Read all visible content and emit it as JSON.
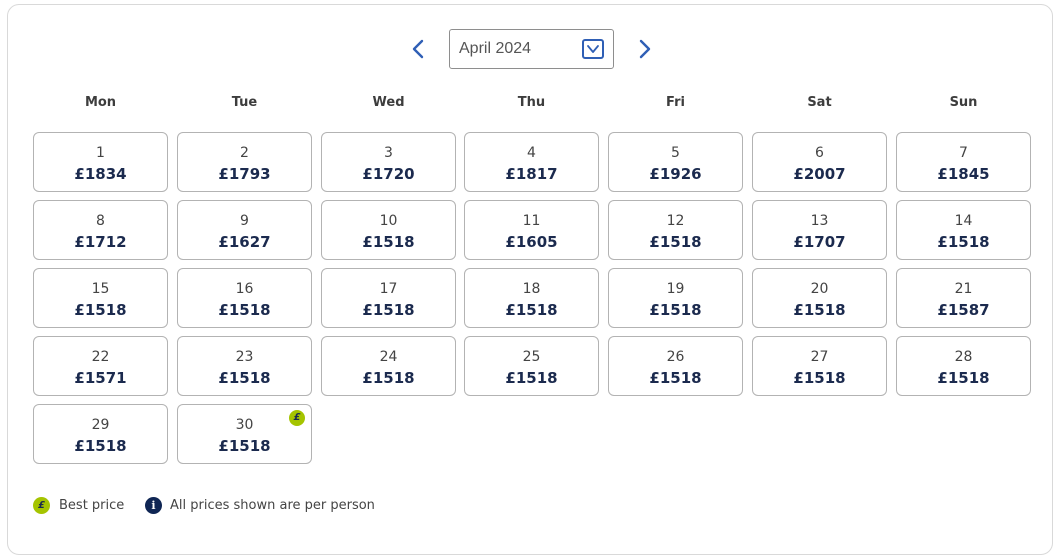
{
  "calendar": {
    "month_label": "April 2024",
    "weekdays": [
      "Mon",
      "Tue",
      "Wed",
      "Thu",
      "Fri",
      "Sat",
      "Sun"
    ],
    "days": [
      {
        "day": "1",
        "price": "£1834"
      },
      {
        "day": "2",
        "price": "£1793"
      },
      {
        "day": "3",
        "price": "£1720"
      },
      {
        "day": "4",
        "price": "£1817"
      },
      {
        "day": "5",
        "price": "£1926"
      },
      {
        "day": "6",
        "price": "£2007"
      },
      {
        "day": "7",
        "price": "£1845"
      },
      {
        "day": "8",
        "price": "£1712"
      },
      {
        "day": "9",
        "price": "£1627"
      },
      {
        "day": "10",
        "price": "£1518"
      },
      {
        "day": "11",
        "price": "£1605"
      },
      {
        "day": "12",
        "price": "£1518"
      },
      {
        "day": "13",
        "price": "£1707"
      },
      {
        "day": "14",
        "price": "£1518"
      },
      {
        "day": "15",
        "price": "£1518"
      },
      {
        "day": "16",
        "price": "£1518"
      },
      {
        "day": "17",
        "price": "£1518"
      },
      {
        "day": "18",
        "price": "£1518"
      },
      {
        "day": "19",
        "price": "£1518"
      },
      {
        "day": "20",
        "price": "£1518"
      },
      {
        "day": "21",
        "price": "£1587"
      },
      {
        "day": "22",
        "price": "£1571"
      },
      {
        "day": "23",
        "price": "£1518"
      },
      {
        "day": "24",
        "price": "£1518"
      },
      {
        "day": "25",
        "price": "£1518"
      },
      {
        "day": "26",
        "price": "£1518"
      },
      {
        "day": "27",
        "price": "£1518"
      },
      {
        "day": "28",
        "price": "£1518"
      },
      {
        "day": "29",
        "price": "£1518"
      },
      {
        "day": "30",
        "price": "£1518",
        "best_price": true
      }
    ]
  },
  "legend": {
    "best_badge_symbol": "£",
    "best_price_label": "Best price",
    "info_symbol": "i",
    "info_text": "All prices shown are per person"
  },
  "icons": {
    "prev": "chevron-left-icon",
    "next": "chevron-right-icon",
    "dropdown": "chevron-down-icon",
    "best_price": "pound-badge-icon",
    "info": "info-icon"
  },
  "colors": {
    "accent": "#2f5fb5",
    "best_price_badge": "#a5c400",
    "price_text": "#1b2a4e",
    "info_icon": "#0f2654"
  }
}
